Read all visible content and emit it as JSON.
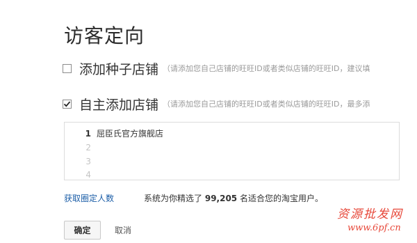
{
  "page": {
    "title": "访客定向"
  },
  "options": [
    {
      "label": "添加种子店铺",
      "hint": "（请添加您自己店铺的旺旺ID或者类似店铺的旺旺ID，建议填",
      "checked": false
    },
    {
      "label": "自主添加店铺",
      "hint": "（请添加您自己店铺的旺旺ID或者类似店铺的旺旺ID，最多添",
      "checked": true
    }
  ],
  "editor": {
    "lines": [
      {
        "num": "1",
        "text": "屈臣氏官方旗舰店"
      },
      {
        "num": "2",
        "text": ""
      },
      {
        "num": "3",
        "text": ""
      },
      {
        "num": "4",
        "text": ""
      }
    ]
  },
  "footer": {
    "fetch_link": "获取圈定人数",
    "status_prefix": "系统为你精选了",
    "status_count": "99,205",
    "status_suffix": "名适合您的淘宝用户。"
  },
  "buttons": {
    "confirm": "确定",
    "cancel": "取消"
  },
  "watermark": {
    "line1": "资源批发网",
    "line2": "www.6pf.cn"
  },
  "colors": {
    "link": "#1d5fa8",
    "watermark": "#e7483a"
  }
}
